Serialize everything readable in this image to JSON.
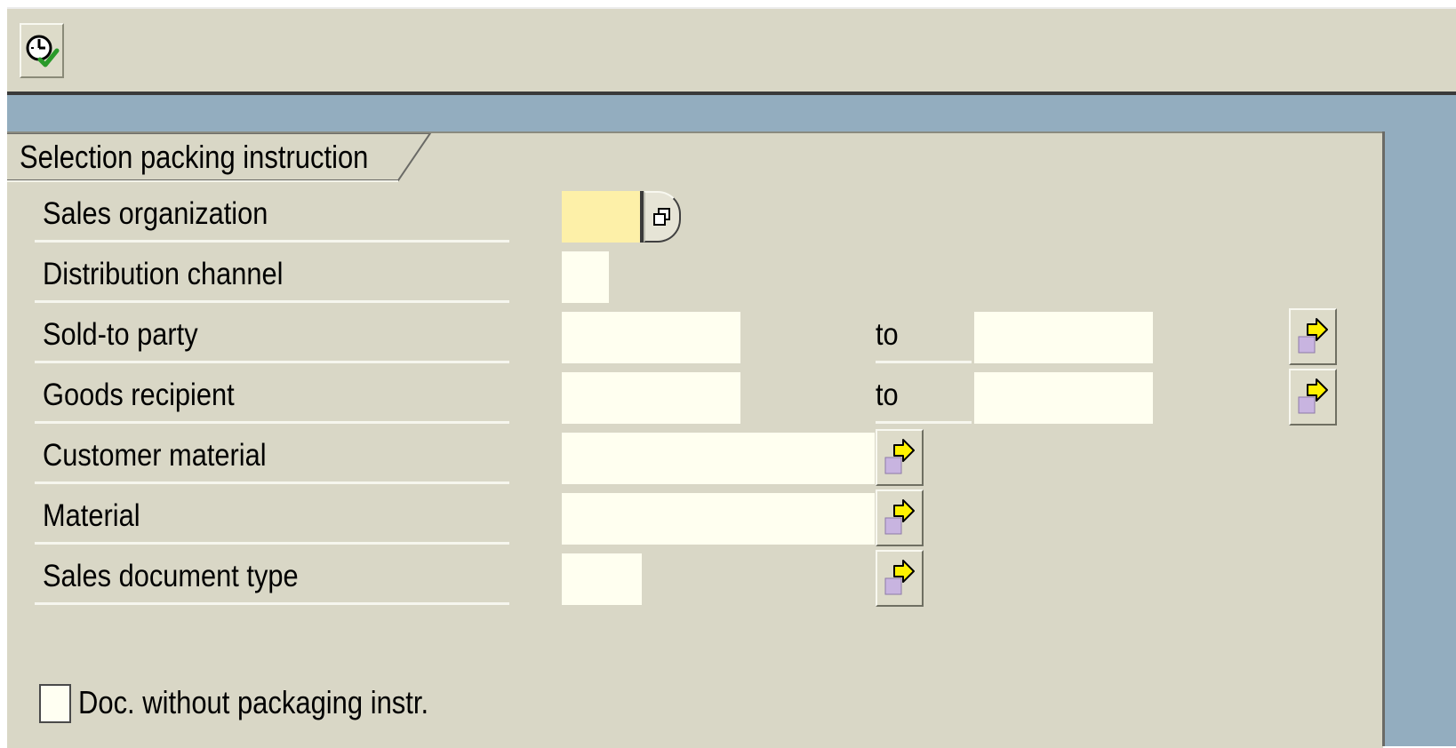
{
  "toolbar": {
    "execute_icon": "execute-clock-check-icon"
  },
  "group": {
    "title": "Selection packing instruction"
  },
  "fields": {
    "sales_org": {
      "label": "Sales organization",
      "value": ""
    },
    "dist_channel": {
      "label": "Distribution channel",
      "value": ""
    },
    "sold_to": {
      "label": "Sold-to party",
      "from": "",
      "to_label": "to",
      "to": ""
    },
    "goods_recipient": {
      "label": "Goods recipient",
      "from": "",
      "to_label": "to",
      "to": ""
    },
    "customer_material": {
      "label": "Customer material",
      "value": ""
    },
    "material": {
      "label": "Material",
      "value": ""
    },
    "sales_doc_type": {
      "label": "Sales document type",
      "value": ""
    }
  },
  "checkbox": {
    "label": "Doc. without packaging instr.",
    "checked": false
  },
  "icons": {
    "multiple_selection": "multiple-selection-arrow-icon",
    "value_help": "value-help-icon"
  },
  "colors": {
    "toolbar_bg": "#d9d7c6",
    "workarea_bg": "#93adbf",
    "input_bg": "#fffff0",
    "required_input_bg": "#fdf0a8",
    "arrow_yellow": "#fff200"
  }
}
